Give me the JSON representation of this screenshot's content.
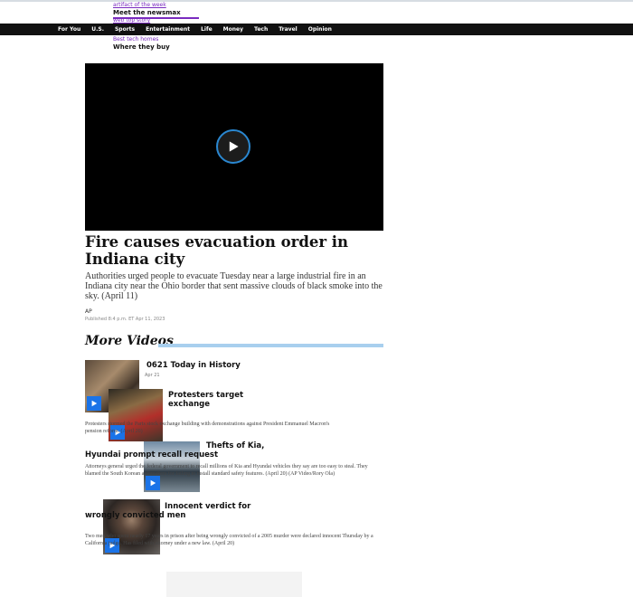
{
  "header": {
    "link_1": "artifact of the week",
    "title_1": "Meet the newsmax",
    "link_2": "web top story"
  },
  "nav": {
    "items": [
      "For You",
      "U.S.",
      "Sports",
      "Entertainment",
      "Life",
      "Money",
      "Tech",
      "Travel",
      "Opinion"
    ]
  },
  "subcrumb": {
    "link": "Best tech homes",
    "title": "Where they buy"
  },
  "article": {
    "headline": "Fire causes evacuation order in Indiana city",
    "summary": "Authorities urged people to evacuate Tuesday near a large industrial fire in an Indiana city near the Ohio border that sent massive clouds of black smoke into the sky. (April 11)",
    "source": "AP",
    "published": "Published 8:4 p.m. ET Apr 11, 2023"
  },
  "more_videos": {
    "title": "More Videos",
    "items": [
      {
        "title": "0621 Today in History",
        "date": "Apr 21",
        "desc": ""
      },
      {
        "title": "Protesters target exchange",
        "date": "",
        "desc": "Protesters stormed the Paris stock exchange building with demonstrations against President Emmanuel Macron's pension reform. (April 20)"
      },
      {
        "title": "Thefts of Kia, Hyundai prompt recall request",
        "date": "",
        "desc": "Attorneys general urged the federal government to recall millions of Kia and Hyundai vehicles they say are too easy to steal. They blamed the South Korean automakers for failing to install standard safety features. (April 20) (AP Video/Rory Ola)"
      },
      {
        "title": "Innocent verdict for wrongly convicted men",
        "date": "",
        "desc": "Two men who spent nearly 17 years in prison after being wrongly convicted of a 2005 murder were declared innocent Thursday by a California judge. Has filed with attorney under a new law. (April 20)"
      }
    ]
  }
}
